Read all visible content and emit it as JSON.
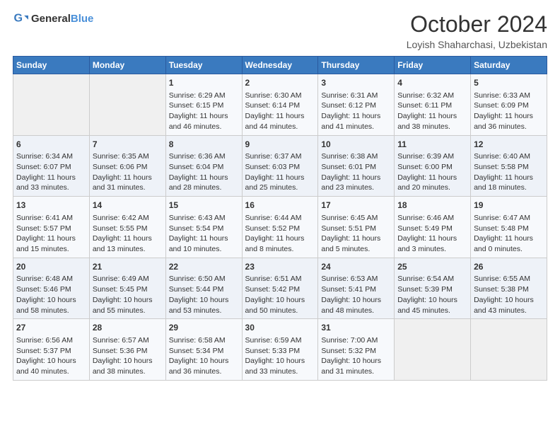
{
  "header": {
    "logo_general": "General",
    "logo_blue": "Blue",
    "month_title": "October 2024",
    "subtitle": "Loyish Shaharchasi, Uzbekistan"
  },
  "days_of_week": [
    "Sunday",
    "Monday",
    "Tuesday",
    "Wednesday",
    "Thursday",
    "Friday",
    "Saturday"
  ],
  "weeks": [
    [
      {
        "day": "",
        "sunrise": "",
        "sunset": "",
        "daylight": ""
      },
      {
        "day": "",
        "sunrise": "",
        "sunset": "",
        "daylight": ""
      },
      {
        "day": "1",
        "sunrise": "Sunrise: 6:29 AM",
        "sunset": "Sunset: 6:15 PM",
        "daylight": "Daylight: 11 hours and 46 minutes."
      },
      {
        "day": "2",
        "sunrise": "Sunrise: 6:30 AM",
        "sunset": "Sunset: 6:14 PM",
        "daylight": "Daylight: 11 hours and 44 minutes."
      },
      {
        "day": "3",
        "sunrise": "Sunrise: 6:31 AM",
        "sunset": "Sunset: 6:12 PM",
        "daylight": "Daylight: 11 hours and 41 minutes."
      },
      {
        "day": "4",
        "sunrise": "Sunrise: 6:32 AM",
        "sunset": "Sunset: 6:11 PM",
        "daylight": "Daylight: 11 hours and 38 minutes."
      },
      {
        "day": "5",
        "sunrise": "Sunrise: 6:33 AM",
        "sunset": "Sunset: 6:09 PM",
        "daylight": "Daylight: 11 hours and 36 minutes."
      }
    ],
    [
      {
        "day": "6",
        "sunrise": "Sunrise: 6:34 AM",
        "sunset": "Sunset: 6:07 PM",
        "daylight": "Daylight: 11 hours and 33 minutes."
      },
      {
        "day": "7",
        "sunrise": "Sunrise: 6:35 AM",
        "sunset": "Sunset: 6:06 PM",
        "daylight": "Daylight: 11 hours and 31 minutes."
      },
      {
        "day": "8",
        "sunrise": "Sunrise: 6:36 AM",
        "sunset": "Sunset: 6:04 PM",
        "daylight": "Daylight: 11 hours and 28 minutes."
      },
      {
        "day": "9",
        "sunrise": "Sunrise: 6:37 AM",
        "sunset": "Sunset: 6:03 PM",
        "daylight": "Daylight: 11 hours and 25 minutes."
      },
      {
        "day": "10",
        "sunrise": "Sunrise: 6:38 AM",
        "sunset": "Sunset: 6:01 PM",
        "daylight": "Daylight: 11 hours and 23 minutes."
      },
      {
        "day": "11",
        "sunrise": "Sunrise: 6:39 AM",
        "sunset": "Sunset: 6:00 PM",
        "daylight": "Daylight: 11 hours and 20 minutes."
      },
      {
        "day": "12",
        "sunrise": "Sunrise: 6:40 AM",
        "sunset": "Sunset: 5:58 PM",
        "daylight": "Daylight: 11 hours and 18 minutes."
      }
    ],
    [
      {
        "day": "13",
        "sunrise": "Sunrise: 6:41 AM",
        "sunset": "Sunset: 5:57 PM",
        "daylight": "Daylight: 11 hours and 15 minutes."
      },
      {
        "day": "14",
        "sunrise": "Sunrise: 6:42 AM",
        "sunset": "Sunset: 5:55 PM",
        "daylight": "Daylight: 11 hours and 13 minutes."
      },
      {
        "day": "15",
        "sunrise": "Sunrise: 6:43 AM",
        "sunset": "Sunset: 5:54 PM",
        "daylight": "Daylight: 11 hours and 10 minutes."
      },
      {
        "day": "16",
        "sunrise": "Sunrise: 6:44 AM",
        "sunset": "Sunset: 5:52 PM",
        "daylight": "Daylight: 11 hours and 8 minutes."
      },
      {
        "day": "17",
        "sunrise": "Sunrise: 6:45 AM",
        "sunset": "Sunset: 5:51 PM",
        "daylight": "Daylight: 11 hours and 5 minutes."
      },
      {
        "day": "18",
        "sunrise": "Sunrise: 6:46 AM",
        "sunset": "Sunset: 5:49 PM",
        "daylight": "Daylight: 11 hours and 3 minutes."
      },
      {
        "day": "19",
        "sunrise": "Sunrise: 6:47 AM",
        "sunset": "Sunset: 5:48 PM",
        "daylight": "Daylight: 11 hours and 0 minutes."
      }
    ],
    [
      {
        "day": "20",
        "sunrise": "Sunrise: 6:48 AM",
        "sunset": "Sunset: 5:46 PM",
        "daylight": "Daylight: 10 hours and 58 minutes."
      },
      {
        "day": "21",
        "sunrise": "Sunrise: 6:49 AM",
        "sunset": "Sunset: 5:45 PM",
        "daylight": "Daylight: 10 hours and 55 minutes."
      },
      {
        "day": "22",
        "sunrise": "Sunrise: 6:50 AM",
        "sunset": "Sunset: 5:44 PM",
        "daylight": "Daylight: 10 hours and 53 minutes."
      },
      {
        "day": "23",
        "sunrise": "Sunrise: 6:51 AM",
        "sunset": "Sunset: 5:42 PM",
        "daylight": "Daylight: 10 hours and 50 minutes."
      },
      {
        "day": "24",
        "sunrise": "Sunrise: 6:53 AM",
        "sunset": "Sunset: 5:41 PM",
        "daylight": "Daylight: 10 hours and 48 minutes."
      },
      {
        "day": "25",
        "sunrise": "Sunrise: 6:54 AM",
        "sunset": "Sunset: 5:39 PM",
        "daylight": "Daylight: 10 hours and 45 minutes."
      },
      {
        "day": "26",
        "sunrise": "Sunrise: 6:55 AM",
        "sunset": "Sunset: 5:38 PM",
        "daylight": "Daylight: 10 hours and 43 minutes."
      }
    ],
    [
      {
        "day": "27",
        "sunrise": "Sunrise: 6:56 AM",
        "sunset": "Sunset: 5:37 PM",
        "daylight": "Daylight: 10 hours and 40 minutes."
      },
      {
        "day": "28",
        "sunrise": "Sunrise: 6:57 AM",
        "sunset": "Sunset: 5:36 PM",
        "daylight": "Daylight: 10 hours and 38 minutes."
      },
      {
        "day": "29",
        "sunrise": "Sunrise: 6:58 AM",
        "sunset": "Sunset: 5:34 PM",
        "daylight": "Daylight: 10 hours and 36 minutes."
      },
      {
        "day": "30",
        "sunrise": "Sunrise: 6:59 AM",
        "sunset": "Sunset: 5:33 PM",
        "daylight": "Daylight: 10 hours and 33 minutes."
      },
      {
        "day": "31",
        "sunrise": "Sunrise: 7:00 AM",
        "sunset": "Sunset: 5:32 PM",
        "daylight": "Daylight: 10 hours and 31 minutes."
      },
      {
        "day": "",
        "sunrise": "",
        "sunset": "",
        "daylight": ""
      },
      {
        "day": "",
        "sunrise": "",
        "sunset": "",
        "daylight": ""
      }
    ]
  ]
}
